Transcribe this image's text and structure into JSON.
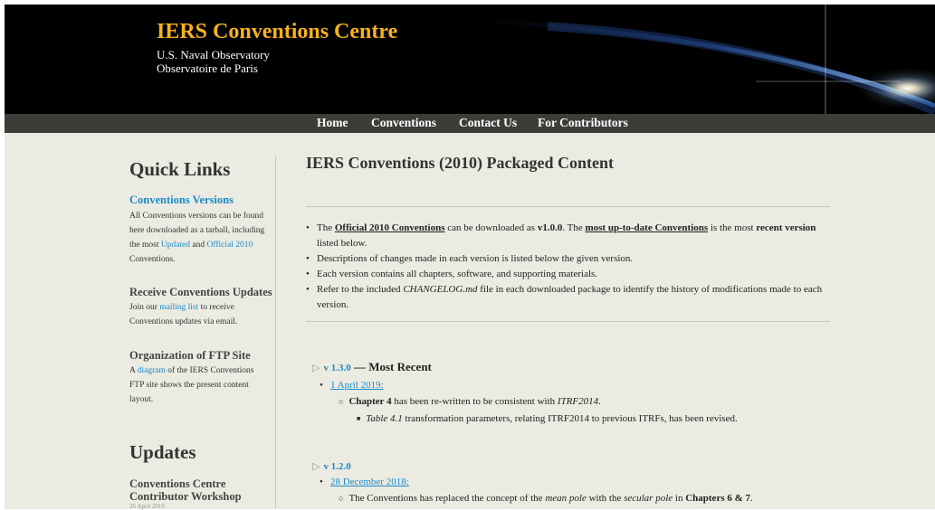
{
  "header": {
    "title": "IERS Conventions Centre",
    "subtitle_1": "U.S. Naval Observatory",
    "subtitle_2": "Observatoire de Paris"
  },
  "nav": [
    "Home",
    "Conventions",
    "Contact Us",
    "For Contributors"
  ],
  "sidebar": {
    "quick_links_title": "Quick Links",
    "versions_title": "Conventions Versions",
    "versions_text_1": "All Conventions versions can be found here downloaded as a tarball, including the most ",
    "versions_link_updated": "Updated",
    "versions_text_and": " and ",
    "versions_link_official": "Official 2010",
    "versions_text_2": " Conventions.",
    "updates_sub_title": "Receive Conventions Updates",
    "updates_text_1": "Join our ",
    "updates_link": "mailing list",
    "updates_text_2": " to receive Conventions updates via email.",
    "ftp_title": "Organization of FTP Site",
    "ftp_text_1": "A ",
    "ftp_link": "diagram",
    "ftp_text_2": " of the IERS Conventions FTP site shows the present content layout.",
    "updates_title": "Updates",
    "workshop_title": "Conventions Centre Contributor Workshop",
    "workshop_date": "26 April 2019"
  },
  "main": {
    "title": "IERS Conventions (2010) Packaged Content",
    "bullet_1": {
      "pre": "The ",
      "link1": "Official 2010 Conventions",
      "mid": " can be downloaded as ",
      "version": "v1.0.0",
      "mid2": ". The ",
      "link2": "most up-to-date Conventions",
      "mid3": " is the most ",
      "bold": "recent version",
      "post": " listed below."
    },
    "bullet_2": "Descriptions of changes made in each version is listed below the given version.",
    "bullet_3": "Each version contains all chapters, software, and supporting materials.",
    "bullet_4": {
      "pre": "Refer to the included ",
      "italic": "CHANGELOG.md",
      "post": " file in each downloaded package to identify the history of modifications made to each version."
    },
    "versions": [
      {
        "label": "v 1.3.0",
        "suffix": " — Most Recent",
        "date": "1 April 2019:",
        "change_bold": "Chapter 4",
        "change_text": " has been re-written to be consistent with ",
        "change_italic": "ITRF2014",
        "change_end": ".",
        "sub_italic": "Table 4.1",
        "sub_text": " transformation parameters, relating ITRF2014 to previous ITRFs, has been revised."
      },
      {
        "label": "v 1.2.0",
        "date": "28 December 2018:",
        "change_text_1": "The Conventions has replaced the concept of the ",
        "change_italic_1": "mean pole",
        "change_text_2": " with the ",
        "change_italic_2": "secular pole",
        "change_text_3": " in ",
        "change_bold": "Chapters 6 & 7",
        "change_end": "."
      }
    ]
  },
  "colors": {
    "title_gold": "#f5b21d",
    "link_blue": "#1a8bc8",
    "nav_bg": "#3b3d38",
    "content_bg": "#ebebe2"
  }
}
